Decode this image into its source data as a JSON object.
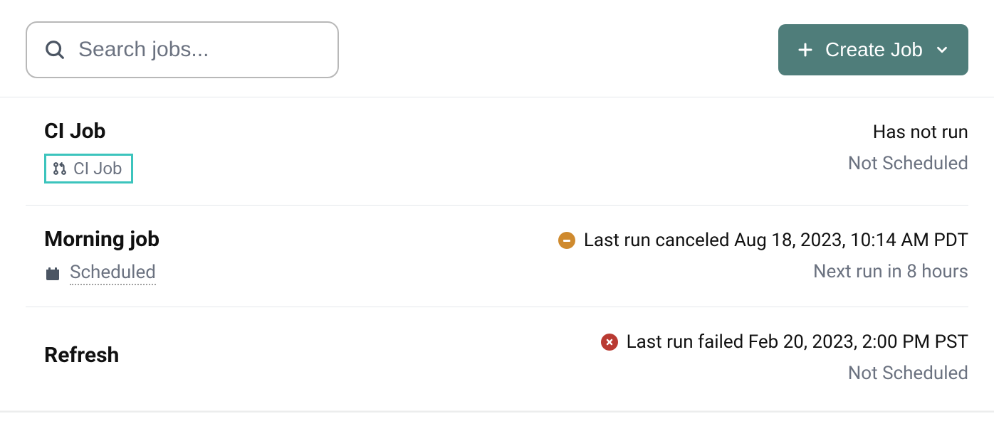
{
  "search": {
    "placeholder": "Search jobs..."
  },
  "create_button": {
    "label": "Create Job"
  },
  "jobs": [
    {
      "title": "CI Job",
      "badge": {
        "type": "ci",
        "label": "CI Job"
      },
      "status_primary": "Has not run",
      "status_secondary": "Not Scheduled"
    },
    {
      "title": "Morning job",
      "badge": {
        "type": "scheduled",
        "label": "Scheduled"
      },
      "status_icon": "canceled",
      "status_primary": "Last run canceled Aug 18, 2023, 10:14 AM PDT",
      "status_secondary": "Next run in 8 hours"
    },
    {
      "title": "Refresh",
      "status_icon": "failed",
      "status_primary": "Last run failed Feb 20, 2023, 2:00 PM PST",
      "status_secondary": "Not Scheduled"
    }
  ],
  "colors": {
    "accent_button": "#4f7d7a",
    "ci_badge_border": "#3cc4bd",
    "cancel_icon": "#cf8a2e",
    "fail_icon": "#b93a32",
    "muted_text": "#6b7280"
  }
}
